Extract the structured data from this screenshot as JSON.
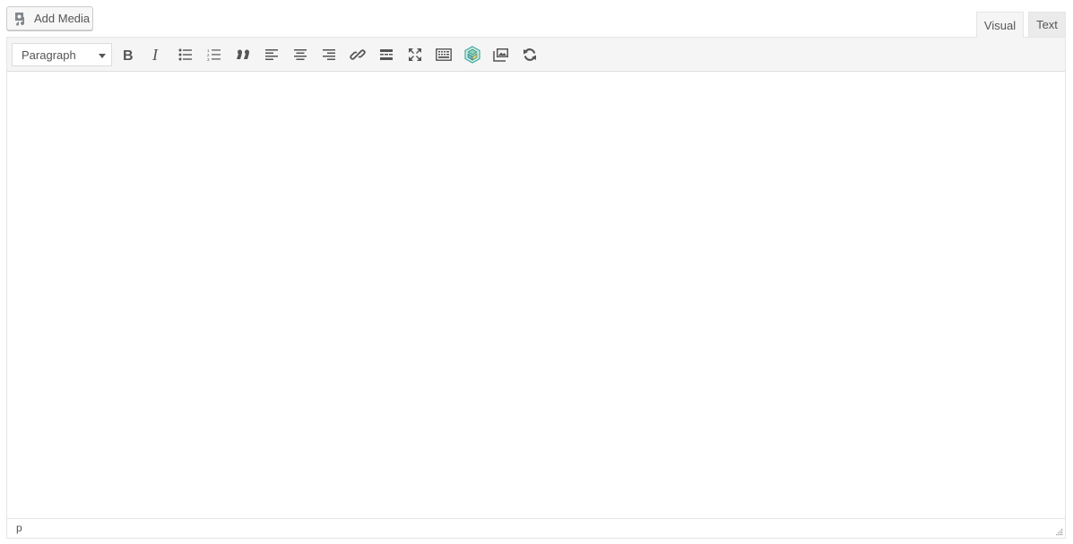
{
  "media_button": {
    "label": "Add Media",
    "icon": "add-media-icon"
  },
  "tabs": [
    {
      "label": "Visual",
      "active": true
    },
    {
      "label": "Text",
      "active": false
    }
  ],
  "toolbar": {
    "format_select": {
      "value": "Paragraph"
    },
    "buttons": [
      {
        "name": "bold-icon"
      },
      {
        "name": "italic-icon"
      },
      {
        "name": "bulleted-list-icon"
      },
      {
        "name": "numbered-list-icon"
      },
      {
        "name": "blockquote-icon"
      },
      {
        "name": "align-left-icon"
      },
      {
        "name": "align-center-icon"
      },
      {
        "name": "align-right-icon"
      },
      {
        "name": "insert-link-icon"
      },
      {
        "name": "read-more-icon"
      },
      {
        "name": "fullscreen-icon"
      },
      {
        "name": "toolbar-toggle-icon"
      },
      {
        "name": "plugin-cube-icon",
        "color": "#3fa9a0"
      },
      {
        "name": "gallery-icon"
      },
      {
        "name": "refresh-icon"
      }
    ]
  },
  "statusbar": {
    "path": "p"
  }
}
